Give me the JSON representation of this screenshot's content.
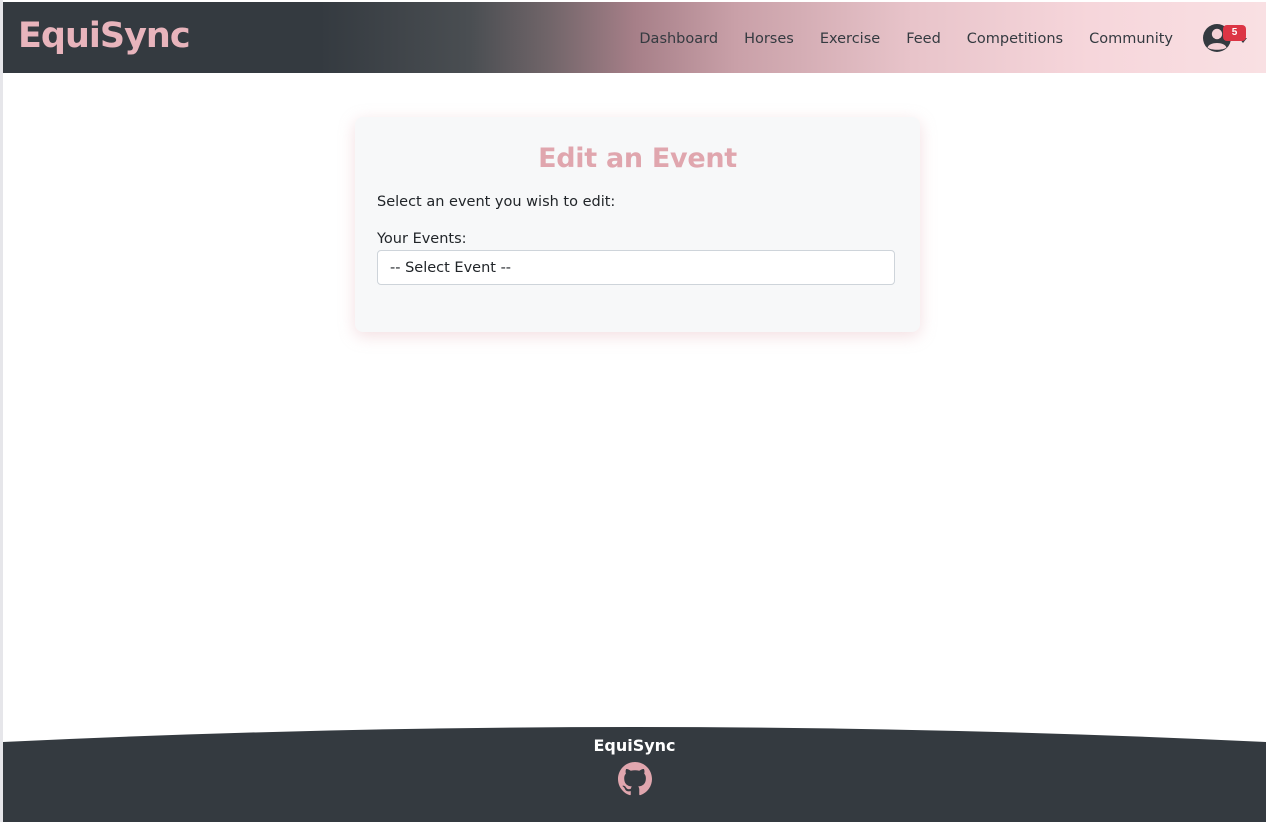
{
  "app": {
    "brand": "EquiSync"
  },
  "nav": {
    "links": [
      "Dashboard",
      "Horses",
      "Exercise",
      "Feed",
      "Competitions",
      "Community"
    ],
    "notification_count": "5"
  },
  "card": {
    "title": "Edit an Event",
    "instruction": "Select an event you wish to edit:",
    "events_label": "Your Events:",
    "select_value": "-- Select Event --"
  },
  "footer": {
    "brand": "EquiSync"
  },
  "icons": {
    "user": "user-circle-icon",
    "caret": "caret-down-icon",
    "github": "github-icon"
  },
  "colors": {
    "brand_pink": "#e8b4bc",
    "title_pink": "#e0a6ae",
    "dark": "#343a40",
    "badge_red": "#dc3545"
  }
}
